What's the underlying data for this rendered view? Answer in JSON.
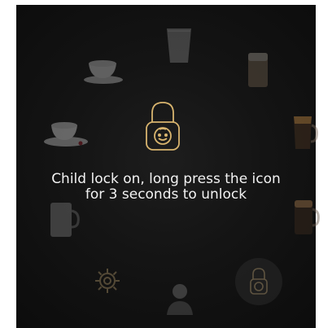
{
  "message": {
    "line1": "Child lock on, long press the icon",
    "line2": "for 3 seconds to unlock"
  },
  "icons": [
    "tall-glass-icon",
    "latte-glass-icon",
    "espresso-glass-icon",
    "mug-icon",
    "settings-gear-icon",
    "user-profile-icon",
    "child-lock-button-icon",
    "glass-mug-icon",
    "saucer-cup-icon",
    "teacup-icon",
    "child-lock-icon"
  ],
  "colors": {
    "accent": "#d8b46e",
    "background": "#111111",
    "text": "#f2f2f2"
  }
}
